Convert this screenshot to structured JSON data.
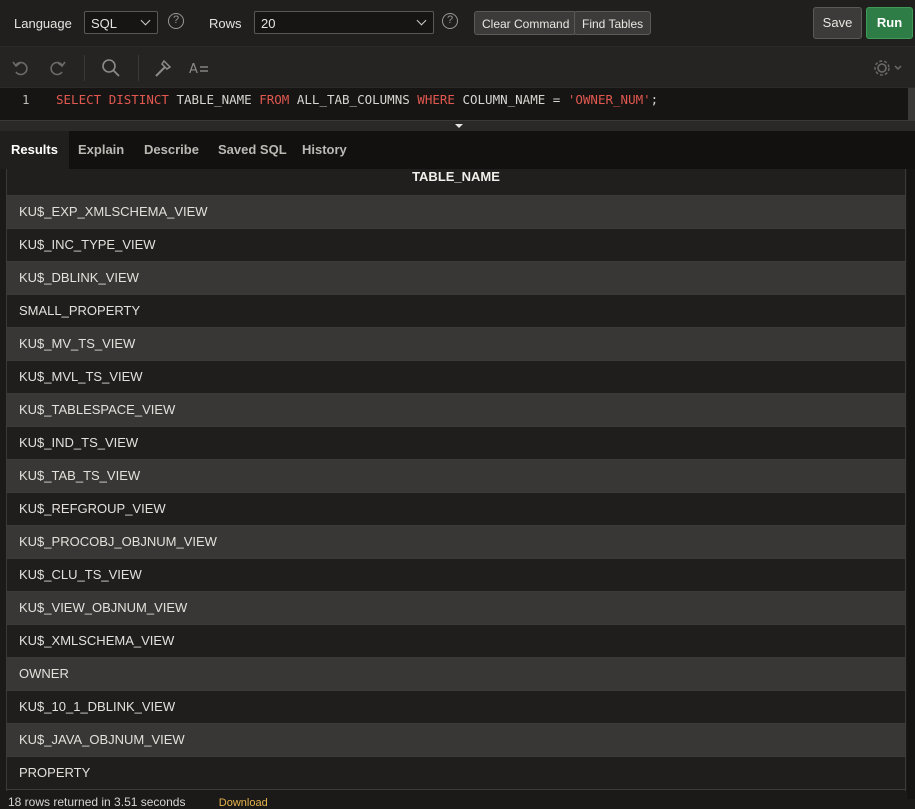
{
  "toolbar": {
    "language_label": "Language",
    "language_value": "SQL",
    "rows_label": "Rows",
    "rows_value": "20",
    "clear_command": "Clear Command",
    "find_tables": "Find Tables",
    "save": "Save",
    "run": "Run"
  },
  "editor": {
    "line_number": "1",
    "tokens": {
      "select": "SELECT",
      "distinct": "DISTINCT",
      "col": "TABLE_NAME",
      "from": "FROM",
      "table": "ALL_TAB_COLUMNS",
      "where": "WHERE",
      "cond_col": "COLUMN_NAME",
      "eq": "=",
      "value": "'OWNER_NUM'",
      "semi": ";"
    },
    "icons": [
      "undo-icon",
      "redo-icon",
      "search-icon",
      "wrench-icon",
      "text-format-icon",
      "gear-icon"
    ]
  },
  "tabs": [
    "Results",
    "Explain",
    "Describe",
    "Saved SQL",
    "History"
  ],
  "results": {
    "column": "TABLE_NAME",
    "rows": [
      "KU$_EXP_XMLSCHEMA_VIEW",
      "KU$_INC_TYPE_VIEW",
      "KU$_DBLINK_VIEW",
      "SMALL_PROPERTY",
      "KU$_MV_TS_VIEW",
      "KU$_MVL_TS_VIEW",
      "KU$_TABLESPACE_VIEW",
      "KU$_IND_TS_VIEW",
      "KU$_TAB_TS_VIEW",
      "KU$_REFGROUP_VIEW",
      "KU$_PROCOBJ_OBJNUM_VIEW",
      "KU$_CLU_TS_VIEW",
      "KU$_VIEW_OBJNUM_VIEW",
      "KU$_XMLSCHEMA_VIEW",
      "OWNER",
      "KU$_10_1_DBLINK_VIEW",
      "KU$_JAVA_OBJNUM_VIEW",
      "PROPERTY"
    ]
  },
  "footer": {
    "status": "18 rows returned in 3.51 seconds",
    "download": "Download"
  },
  "colors": {
    "run_green": "#2f7d46",
    "keyword_red": "#e0584f",
    "download_gold": "#e5b24a"
  }
}
